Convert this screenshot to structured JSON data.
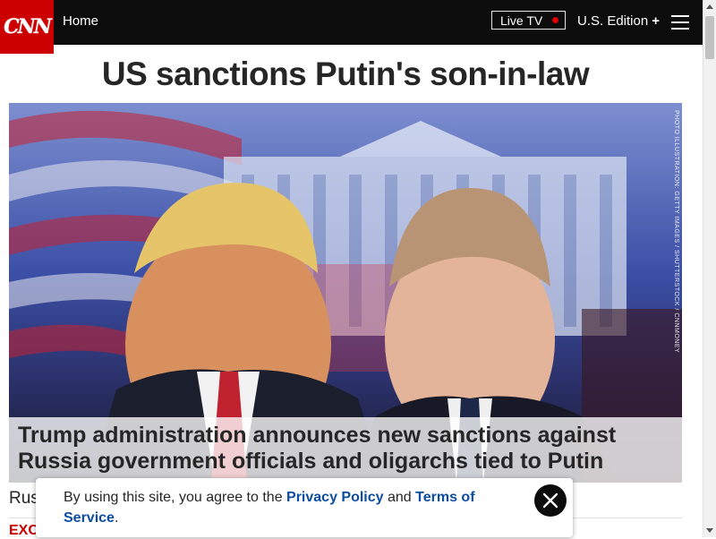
{
  "header": {
    "logo_text": "CNN",
    "home_label": "Home",
    "live_tv_label": "Live TV",
    "edition_label": "U.S. Edition",
    "edition_plus": "+",
    "menu_icon": "hamburger-menu-icon",
    "brand_color": "#cc0000",
    "bar_color": "#0c0c0c"
  },
  "article": {
    "headline": "US sanctions Putin's son-in-law",
    "image_credit": "PHOTO ILLUSTRATION: GETTY IMAGES / SHUTTERSTOCK / CNNMONEY",
    "image_caption": "Trump administration announces new sanctions against Russia government officials and oligarchs tied to Putin",
    "teaser_partial": "Rus",
    "kicker_partial": "EXC"
  },
  "cookie_notice": {
    "text_before": "By using this site, you agree to the ",
    "privacy_link": "Privacy Policy",
    "text_middle": " and ",
    "terms_link": "Terms of Service",
    "text_after": ".",
    "close_icon": "close-icon",
    "link_color": "#0c4da2"
  }
}
